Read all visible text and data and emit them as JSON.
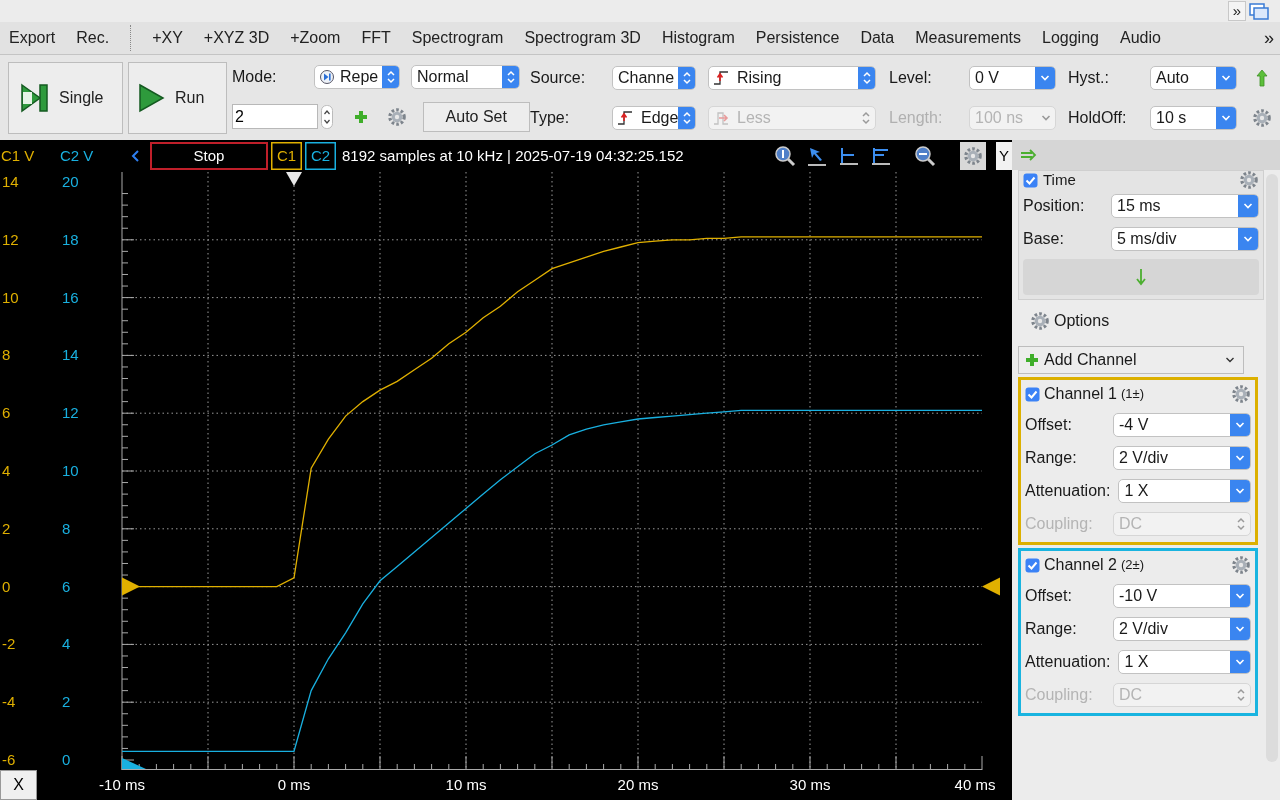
{
  "window_bar": {
    "overflow": "»"
  },
  "menu": {
    "items": [
      "Export",
      "Rec.",
      "+XY",
      "+XYZ 3D",
      "+Zoom",
      "FFT",
      "Spectrogram",
      "Spectrogram 3D",
      "Histogram",
      "Persistence",
      "Data",
      "Measurements",
      "Logging",
      "Audio"
    ],
    "overflow": "»"
  },
  "toolbar": {
    "single_button": "Single",
    "run_button": "Run",
    "mode_label": "Mode:",
    "mode": {
      "value": "Repe",
      "kind": "popup",
      "disabled": false
    },
    "trigger_mode": {
      "value": "Normal",
      "kind": "popup",
      "disabled": false
    },
    "count": "2",
    "auto_set_button": "Auto Set",
    "source_label": "Source:",
    "source": {
      "value": "Channe",
      "kind": "popup",
      "disabled": false
    },
    "condition": {
      "value": "Rising",
      "kind": "popup",
      "disabled": false
    },
    "type_label": "Type:",
    "type": {
      "value": "Edge",
      "kind": "popup",
      "disabled": false
    },
    "length_condition": {
      "value": "Less",
      "kind": "popup",
      "disabled": true
    },
    "length_label": {
      "text": "Length:",
      "disabled": true
    },
    "length": {
      "value": "100 ns",
      "kind": "combo",
      "disabled": true
    },
    "level_label": "Level:",
    "level": {
      "value": "0 V",
      "kind": "combo",
      "disabled": false
    },
    "hyst_label": "Hyst.:",
    "hyst": {
      "value": "Auto",
      "kind": "combo",
      "disabled": false
    },
    "holdoff_label": "HoldOff:",
    "holdoff": {
      "value": "10 s",
      "kind": "combo",
      "disabled": false
    }
  },
  "scope": {
    "c2_axis_label": "C2 V",
    "stop_button": "Stop",
    "info": "8192 samples at 10 kHz | 2025-07-19 04:32:25.152",
    "y_tab": "Y",
    "c2_ticks": [
      "20",
      "18",
      "16",
      "14",
      "12",
      "10",
      "8",
      "6",
      "4",
      "2",
      "0"
    ],
    "x_button": "X",
    "chart_data": {
      "type": "line",
      "ylabel": "C1 V",
      "xlim": [
        -10,
        40
      ],
      "ylim": [
        -6,
        14
      ],
      "xticks": [
        {
          "value": -10,
          "label": "-10 ms"
        },
        {
          "value": 0,
          "label": "0 ms"
        },
        {
          "value": 10,
          "label": "10 ms"
        },
        {
          "value": 20,
          "label": "20 ms"
        },
        {
          "value": 30,
          "label": "30 ms"
        },
        {
          "value": 40,
          "label": "40 ms"
        }
      ],
      "yticks": [
        14,
        12,
        10,
        8,
        6,
        4,
        2,
        0,
        -2,
        -4,
        -6
      ],
      "x": [
        -10,
        -9,
        -8,
        -7,
        -6,
        -5,
        -4,
        -3,
        -2,
        -1,
        0,
        1,
        2,
        3,
        4,
        5,
        6,
        7,
        8,
        9,
        10,
        11,
        12,
        13,
        14,
        15,
        16,
        17,
        18,
        19,
        20,
        21,
        22,
        23,
        24,
        25,
        26,
        27,
        28,
        29,
        30,
        31,
        32,
        33,
        34,
        35,
        36,
        37,
        38,
        39,
        40
      ],
      "series": [
        {
          "name": "C1",
          "color": "#e0b000",
          "values": [
            0,
            0,
            0,
            0,
            0,
            0,
            0,
            0,
            0,
            0,
            0.3,
            4.1,
            5.1,
            5.9,
            6.4,
            6.8,
            7.1,
            7.5,
            7.9,
            8.4,
            8.8,
            9.3,
            9.7,
            10.2,
            10.6,
            11.0,
            11.2,
            11.4,
            11.6,
            11.75,
            11.9,
            11.95,
            12.0,
            12.0,
            12.05,
            12.05,
            12.1,
            12.1,
            12.1,
            12.1,
            12.1,
            12.1,
            12.1,
            12.1,
            12.1,
            12.1,
            12.1,
            12.1,
            12.1,
            12.1,
            12.1
          ]
        },
        {
          "name": "C2",
          "color": "#19b0e0",
          "values": [
            -5.7,
            -5.7,
            -5.7,
            -5.7,
            -5.7,
            -5.7,
            -5.7,
            -5.7,
            -5.7,
            -5.7,
            -5.7,
            -3.6,
            -2.5,
            -1.6,
            -0.6,
            0.2,
            0.7,
            1.2,
            1.7,
            2.2,
            2.7,
            3.2,
            3.7,
            4.15,
            4.6,
            4.9,
            5.25,
            5.45,
            5.6,
            5.7,
            5.8,
            5.85,
            5.9,
            5.95,
            6.0,
            6.05,
            6.1,
            6.1,
            6.1,
            6.1,
            6.1,
            6.1,
            6.1,
            6.1,
            6.1,
            6.1,
            6.1,
            6.1,
            6.1,
            6.1,
            6.1
          ]
        }
      ],
      "grid": true
    }
  },
  "panel": {
    "time": {
      "title": "Time",
      "checked": true,
      "rows": [
        {
          "label": "Position:",
          "value": "15 ms",
          "kind": "combo",
          "disabled": false
        },
        {
          "label": "Base:",
          "value": "5 ms/div",
          "kind": "combo",
          "disabled": false
        }
      ]
    },
    "options": "Options",
    "add_channel": "Add Channel",
    "channels": [
      {
        "title": "Channel 1",
        "tag": "(1±)",
        "checked": true,
        "color": "#dcb000",
        "rows": [
          {
            "label": "Offset:",
            "value": "-4 V",
            "kind": "combo",
            "disabled": false
          },
          {
            "label": "Range:",
            "value": "2 V/div",
            "kind": "combo",
            "disabled": false
          },
          {
            "label": "Attenuation:",
            "value": "1 X",
            "kind": "combo",
            "disabled": false
          },
          {
            "label": "Coupling:",
            "value": "DC",
            "kind": "popup",
            "disabled": true
          }
        ]
      },
      {
        "title": "Channel 2",
        "tag": "(2±)",
        "checked": true,
        "color": "#19b4e0",
        "rows": [
          {
            "label": "Offset:",
            "value": "-10 V",
            "kind": "combo",
            "disabled": false
          },
          {
            "label": "Range:",
            "value": "2 V/div",
            "kind": "combo",
            "disabled": false
          },
          {
            "label": "Attenuation:",
            "value": "1 X",
            "kind": "combo",
            "disabled": false
          },
          {
            "label": "Coupling:",
            "value": "DC",
            "kind": "popup",
            "disabled": true
          }
        ]
      }
    ]
  }
}
